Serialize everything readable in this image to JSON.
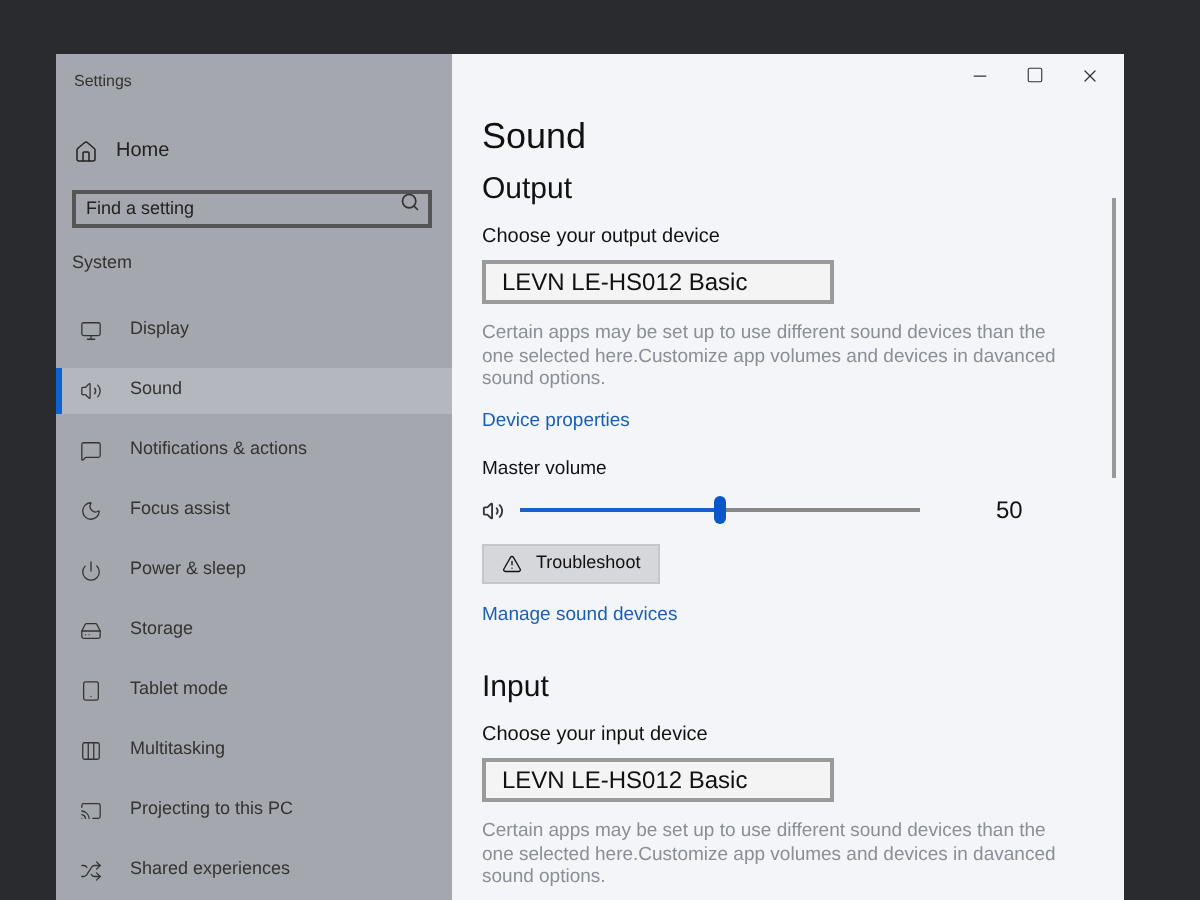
{
  "window": {
    "title": "Settings"
  },
  "sidebar": {
    "home": "Home",
    "search": {
      "placeholder": "Find a setting"
    },
    "section": "System",
    "items": [
      {
        "label": "Display",
        "selected": false
      },
      {
        "label": "Sound",
        "selected": true
      },
      {
        "label": "Notifications & actions",
        "selected": false
      },
      {
        "label": "Focus assist",
        "selected": false
      },
      {
        "label": "Power & sleep",
        "selected": false
      },
      {
        "label": "Storage",
        "selected": false
      },
      {
        "label": "Tablet mode",
        "selected": false
      },
      {
        "label": "Multitasking",
        "selected": false
      },
      {
        "label": "Projecting to this PC",
        "selected": false
      },
      {
        "label": "Shared experiences",
        "selected": false
      }
    ]
  },
  "content": {
    "title": "Sound",
    "output": {
      "heading": "Output",
      "device_label": "Choose your output device",
      "device": "LEVN LE-HS012 Basic",
      "note": "Certain apps may be set up to use different sound devices than the one selected here.Customize app volumes and devices in davanced sound options.",
      "link": "Device properties",
      "volume": {
        "label": "Master volume",
        "level": 0.5,
        "reading": "50"
      },
      "troubleshoot": "Troubleshoot",
      "manage_link": "Manage sound devices"
    },
    "input": {
      "heading": "Input",
      "device_label": "Choose your input device",
      "device": "LEVN LE-HS012 Basic",
      "note": "Certain apps may be set up to use different sound devices than the one selected here.Customize app volumes and devices in davanced sound options."
    }
  }
}
